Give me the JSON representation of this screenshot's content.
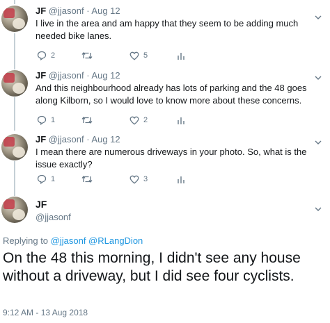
{
  "tweets": [
    {
      "name": "JF",
      "handle": "@jjasonf",
      "date": "· Aug 12",
      "text": "I live in the area and am happy that they seem to be adding much needed bike lanes.",
      "replies": "2",
      "retweets": "",
      "likes": "5"
    },
    {
      "name": "JF",
      "handle": "@jjasonf",
      "date": "· Aug 12",
      "text": "And this neighbourhood already has lots of parking and the 48 goes along Kilborn, so I would love to know more about these concerns.",
      "replies": "1",
      "retweets": "",
      "likes": "2"
    },
    {
      "name": "JF",
      "handle": "@jjasonf",
      "date": "· Aug 12",
      "text": "I mean there are numerous driveways in your photo. So, what is the issue exactly?",
      "replies": "1",
      "retweets": "",
      "likes": "3"
    }
  ],
  "focused": {
    "name": "JF",
    "handle": "@jjasonf",
    "reply_prefix": "Replying to ",
    "reply_handles": "@jjasonf @RLangDion",
    "text": "On the 48 this morning, I didn't see any house without a driveway, but I did see four cyclists.",
    "timestamp": "9:12 AM - 13 Aug 2018"
  },
  "icons": {
    "reply": "speech-bubble-icon",
    "retweet": "retweet-arrows-icon",
    "like": "heart-icon",
    "analytics": "bar-chart-icon",
    "menu": "chevron-down-icon",
    "avatar": "profile-photo"
  },
  "colors": {
    "text": "#14171a",
    "muted": "#657786",
    "link": "#1b95e0",
    "thread": "#c4cfd6"
  }
}
